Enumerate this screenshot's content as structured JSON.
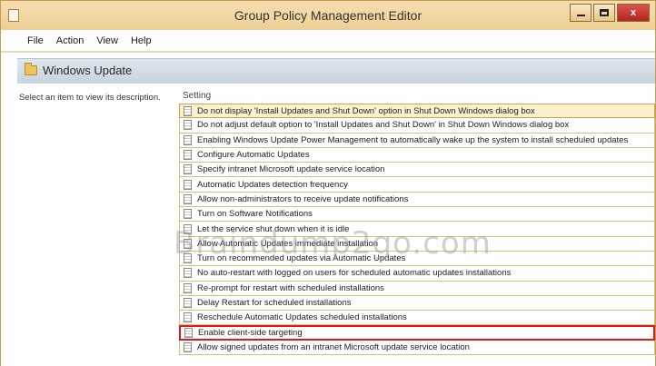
{
  "window": {
    "title": "Group Policy Management Editor",
    "controls": {
      "minimize": "",
      "maximize": "",
      "close": "x"
    }
  },
  "menu": [
    "File",
    "Action",
    "View",
    "Help"
  ],
  "header": {
    "title": "Windows Update",
    "icon": "folder-icon"
  },
  "description_pane": {
    "text": "Select an item to view its description."
  },
  "settings": {
    "column_header": "Setting",
    "items": [
      "Do not display 'Install Updates and Shut Down' option in Shut Down Windows dialog box",
      "Do not adjust default option to 'Install Updates and Shut Down' in Shut Down Windows dialog box",
      "Enabling Windows Update Power Management to automatically wake up the system to install scheduled updates",
      "Configure Automatic Updates",
      "Specify intranet Microsoft update service location",
      "Automatic Updates detection frequency",
      "Allow non-administrators to receive update notifications",
      "Turn on Software Notifications",
      "Let the service shut down when it is idle",
      "Allow Automatic Updates immediate installation",
      "Turn on recommended updates via Automatic Updates",
      "No auto-restart with logged on users for scheduled automatic updates installations",
      "Re-prompt for restart with scheduled installations",
      "Delay Restart for scheduled installations",
      "Reschedule Automatic Updates scheduled installations",
      "Enable client-side targeting",
      "Allow signed updates from an intranet Microsoft update service location"
    ],
    "highlighted_index": 15
  },
  "watermark": "Braindump2go.com",
  "colors": {
    "highlight_border": "#d81c1c",
    "title_bar": "#f3d9a6"
  }
}
